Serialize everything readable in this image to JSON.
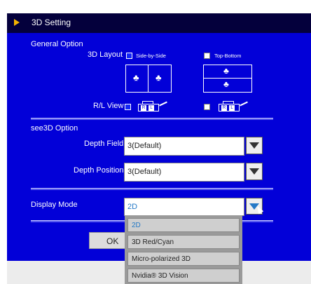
{
  "window": {
    "title": "3D Setting"
  },
  "general": {
    "heading": "General Option",
    "layout_label": "3D Layout",
    "side_by_side": "Side-by-Side",
    "top_bottom": "Top-Bottom",
    "rl_view_label": "R/L View",
    "cam_left_letters": [
      "R",
      "L"
    ],
    "cam_right_letters": [
      "R",
      "L"
    ]
  },
  "see3d": {
    "heading": "see3D Option",
    "depth_field_label": "Depth Field",
    "depth_field_value": "3(Default)",
    "depth_position_label": "Depth Position",
    "depth_position_value": "3(Default)"
  },
  "display": {
    "label": "Display Mode",
    "value": "2D",
    "options": [
      "2D",
      "3D Red/Cyan",
      "Micro-polarized 3D",
      "Nvidia® 3D Vision"
    ]
  },
  "buttons": {
    "ok": "OK"
  },
  "colors": {
    "panel": "#0200d8",
    "titlebar": "#04003c",
    "accent_arrow": "#f4b400",
    "dropdown_text": "#2479c6"
  }
}
